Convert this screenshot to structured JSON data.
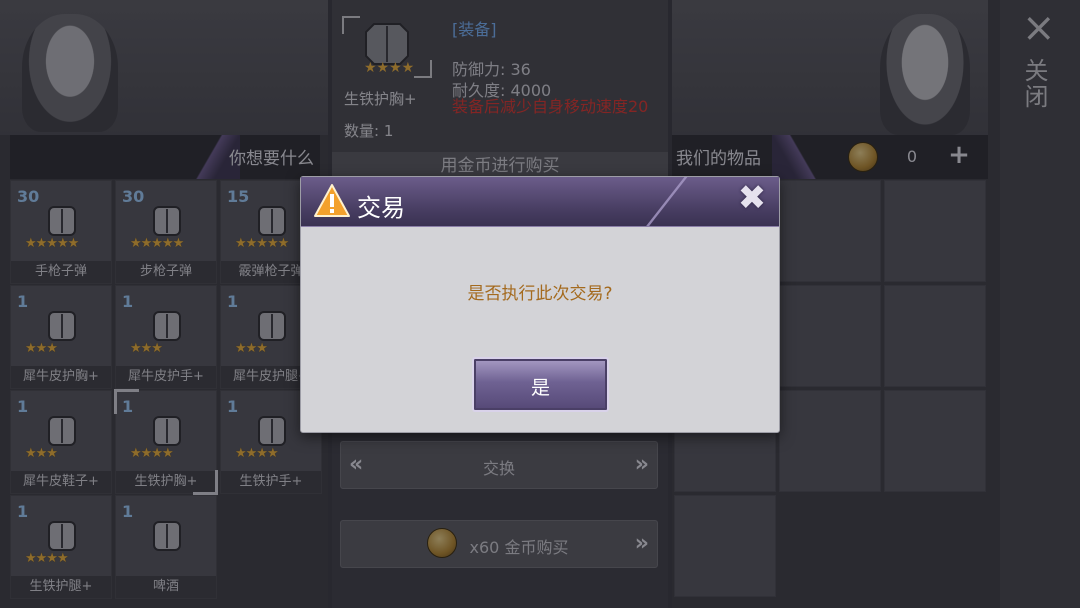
{
  "colors": {
    "accent_purple": "#5c4f80",
    "warning_red": "#e0342c",
    "message_orange": "#a46a1e",
    "qty_blue": "#9fd0ff",
    "category_blue": "#79b7ff",
    "star_gold": "#f2b43a"
  },
  "left_panel": {
    "header": "你想要什么",
    "items": [
      {
        "qty": "30",
        "name": "手枪子弹",
        "icon": "pistol-ammo-icon",
        "stars": "★★★★★"
      },
      {
        "qty": "30",
        "name": "步枪子弹",
        "icon": "rifle-ammo-icon",
        "stars": "★★★★★"
      },
      {
        "qty": "15",
        "name": "霰弹枪子弹",
        "icon": "shotgun-ammo-icon",
        "stars": "★★★★★"
      },
      {
        "qty": "1",
        "name": "犀牛皮护胸+",
        "icon": "chest-armor-icon",
        "stars": "★★★"
      },
      {
        "qty": "1",
        "name": "犀牛皮护手+",
        "icon": "gloves-icon",
        "stars": "★★★"
      },
      {
        "qty": "1",
        "name": "犀牛皮护腿+",
        "icon": "leg-armor-icon",
        "stars": "★★★"
      },
      {
        "qty": "1",
        "name": "犀牛皮鞋子+",
        "icon": "boots-icon",
        "stars": "★★★"
      },
      {
        "qty": "1",
        "name": "生铁护胸+",
        "icon": "iron-chest-armor-icon",
        "stars": "★★★★"
      },
      {
        "qty": "1",
        "name": "生铁护手+",
        "icon": "iron-gloves-icon",
        "stars": "★★★★"
      },
      {
        "qty": "1",
        "name": "生铁护腿+",
        "icon": "iron-leg-armor-icon",
        "stars": "★★★★"
      },
      {
        "qty": "1",
        "name": "啤酒",
        "icon": "beer-bottle-icon",
        "stars": ""
      }
    ]
  },
  "detail": {
    "stars": "★★★★",
    "item_name": "生铁护胸+",
    "count": "数量: 1",
    "category": "[装备]",
    "defense": "防御力: 36",
    "durability": "耐久度: 4000",
    "warning": "装备后减少自身移动速度20",
    "buy_with_gold": "用金币进行购买",
    "exchange": "交换",
    "buy_price": "x60 金币购买",
    "exchange_left_chevron": "«",
    "exchange_right_chevron": "»",
    "buy_chevron": "»"
  },
  "right_panel": {
    "header": "我们的物品",
    "gold": "0",
    "add": "+"
  },
  "close_panel": {
    "icon": "×",
    "label": "关闭"
  },
  "modal": {
    "title": "交易",
    "message": "是否执行此次交易?",
    "confirm": "是",
    "close": "✖"
  }
}
